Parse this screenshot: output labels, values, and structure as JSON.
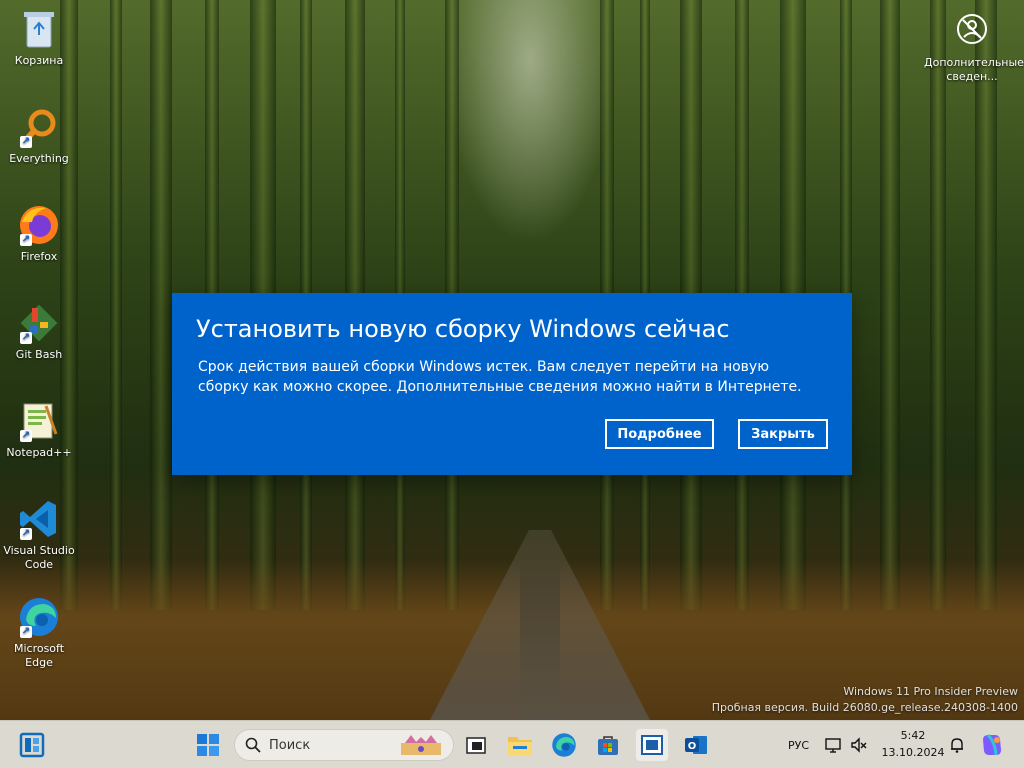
{
  "desktop": {
    "icons": [
      {
        "label": "Корзина",
        "icon": "recycle-bin-icon"
      },
      {
        "label": "Everything",
        "icon": "everything-search-icon"
      },
      {
        "label": "Firefox",
        "icon": "firefox-icon"
      },
      {
        "label": "Git Bash",
        "icon": "git-bash-icon"
      },
      {
        "label": "Notepad++",
        "icon": "notepad-plus-plus-icon"
      },
      {
        "label": "Visual Studio Code",
        "icon": "vscode-icon"
      },
      {
        "label": "Microsoft Edge",
        "icon": "edge-icon"
      }
    ],
    "widget": {
      "label": "Дополнительные сведен...",
      "icon": "info-widget-icon"
    }
  },
  "dialog": {
    "title": "Установить новую сборку Windows сейчас",
    "message": "Срок действия вашей сборки Windows истек. Вам следует перейти на новую сборку как можно скорее. Дополнительные сведения можно найти в Интернете.",
    "more_button": "Подробнее",
    "close_button": "Закрыть",
    "color": "#0063cc"
  },
  "watermark": {
    "line1": "Windows 11 Pro Insider Preview",
    "line2": "Пробная версия. Build 26080.ge_release.240308-1400"
  },
  "taskbar": {
    "search_placeholder": "Поиск",
    "apps": [
      "widgets-icon",
      "start-icon",
      "task-view-icon",
      "file-explorer-icon",
      "edge-icon",
      "microsoft-store-icon",
      "terminal-icon",
      "outlook-icon"
    ],
    "language": "РУС",
    "time": "5:42",
    "date": "13.10.2024"
  }
}
